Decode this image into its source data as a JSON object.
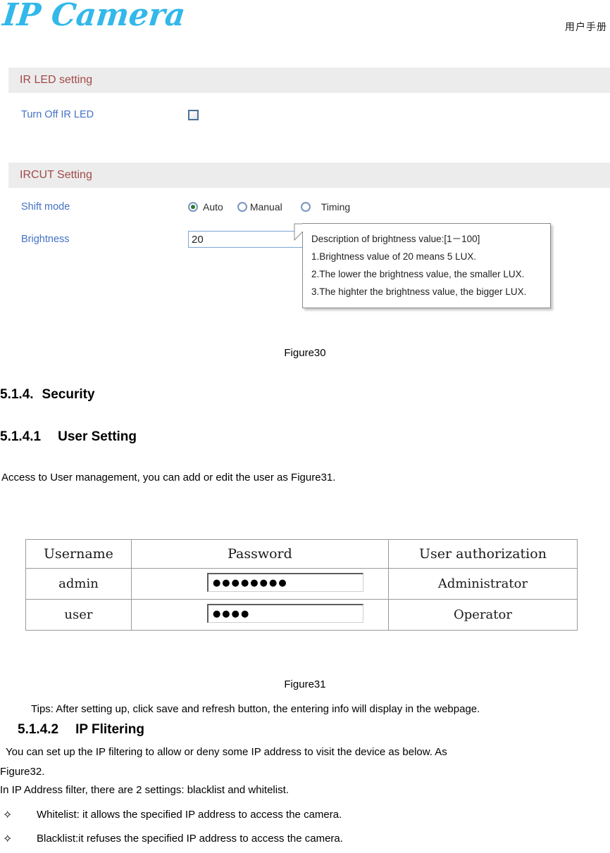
{
  "header": {
    "logo_text": "IP Camera",
    "manual_label": "用户手册",
    "logo_color": "#32b8ea"
  },
  "ir_led_panel": {
    "title": "IR LED setting",
    "rows": [
      {
        "label": "Turn Off IR LED",
        "control": "checkbox",
        "checked": false
      }
    ]
  },
  "ircut_panel": {
    "title": "IRCUT Setting",
    "shift_mode": {
      "label": "Shift mode",
      "options": [
        {
          "label": "Auto",
          "selected": true
        },
        {
          "label": "Manual",
          "selected": false
        },
        {
          "label": "Timing",
          "selected": false
        }
      ]
    },
    "brightness": {
      "label": "Brightness",
      "value": "20",
      "placeholder": ""
    },
    "tooltip": {
      "lines": [
        "Description of brightness value:[1－100]",
        "1.Brightness value of 20 means 5 LUX.",
        "2.The lower the brightness value, the smaller LUX.",
        "3.The highter the brightness value, the bigger LUX."
      ]
    }
  },
  "captions": {
    "figure30": "Figure30",
    "figure31": "Figure31"
  },
  "sections": {
    "security_number": "5.1.4.",
    "security_title": "Security",
    "user_setting_number": "5.1.4.1",
    "user_setting_title": "User Setting",
    "ip_filtering_number": "5.1.4.2",
    "ip_filtering_title": "IP Flitering"
  },
  "paragraphs": {
    "user_intro": "Access to User management, you can add or edit the user as Figure31.",
    "tips": "Tips: After setting up, click save and refresh button, the entering info will display in the webpage.",
    "ip_intro_line1": "You can set up the IP filtering to allow or deny some IP address to visit the device as below. As",
    "ip_intro_line2": "Figure32.",
    "ip_settings": "In IP Address filter, there are 2 settings: blacklist and whitelist."
  },
  "bullets": [
    {
      "mark": "✧",
      "text": "Whitelist: it allows the specified IP address to access the camera."
    },
    {
      "mark": "✧",
      "text": "Blacklist:it refuses the specified IP address to access the camera."
    }
  ],
  "user_table": {
    "headers": [
      "Username",
      "Password",
      "User authorization"
    ],
    "rows": [
      {
        "username": "admin",
        "password_mask": "●●●●●●●●",
        "authorization": "Administrator"
      },
      {
        "username": "user",
        "password_mask": "●●●●",
        "authorization": "Operator"
      }
    ]
  }
}
